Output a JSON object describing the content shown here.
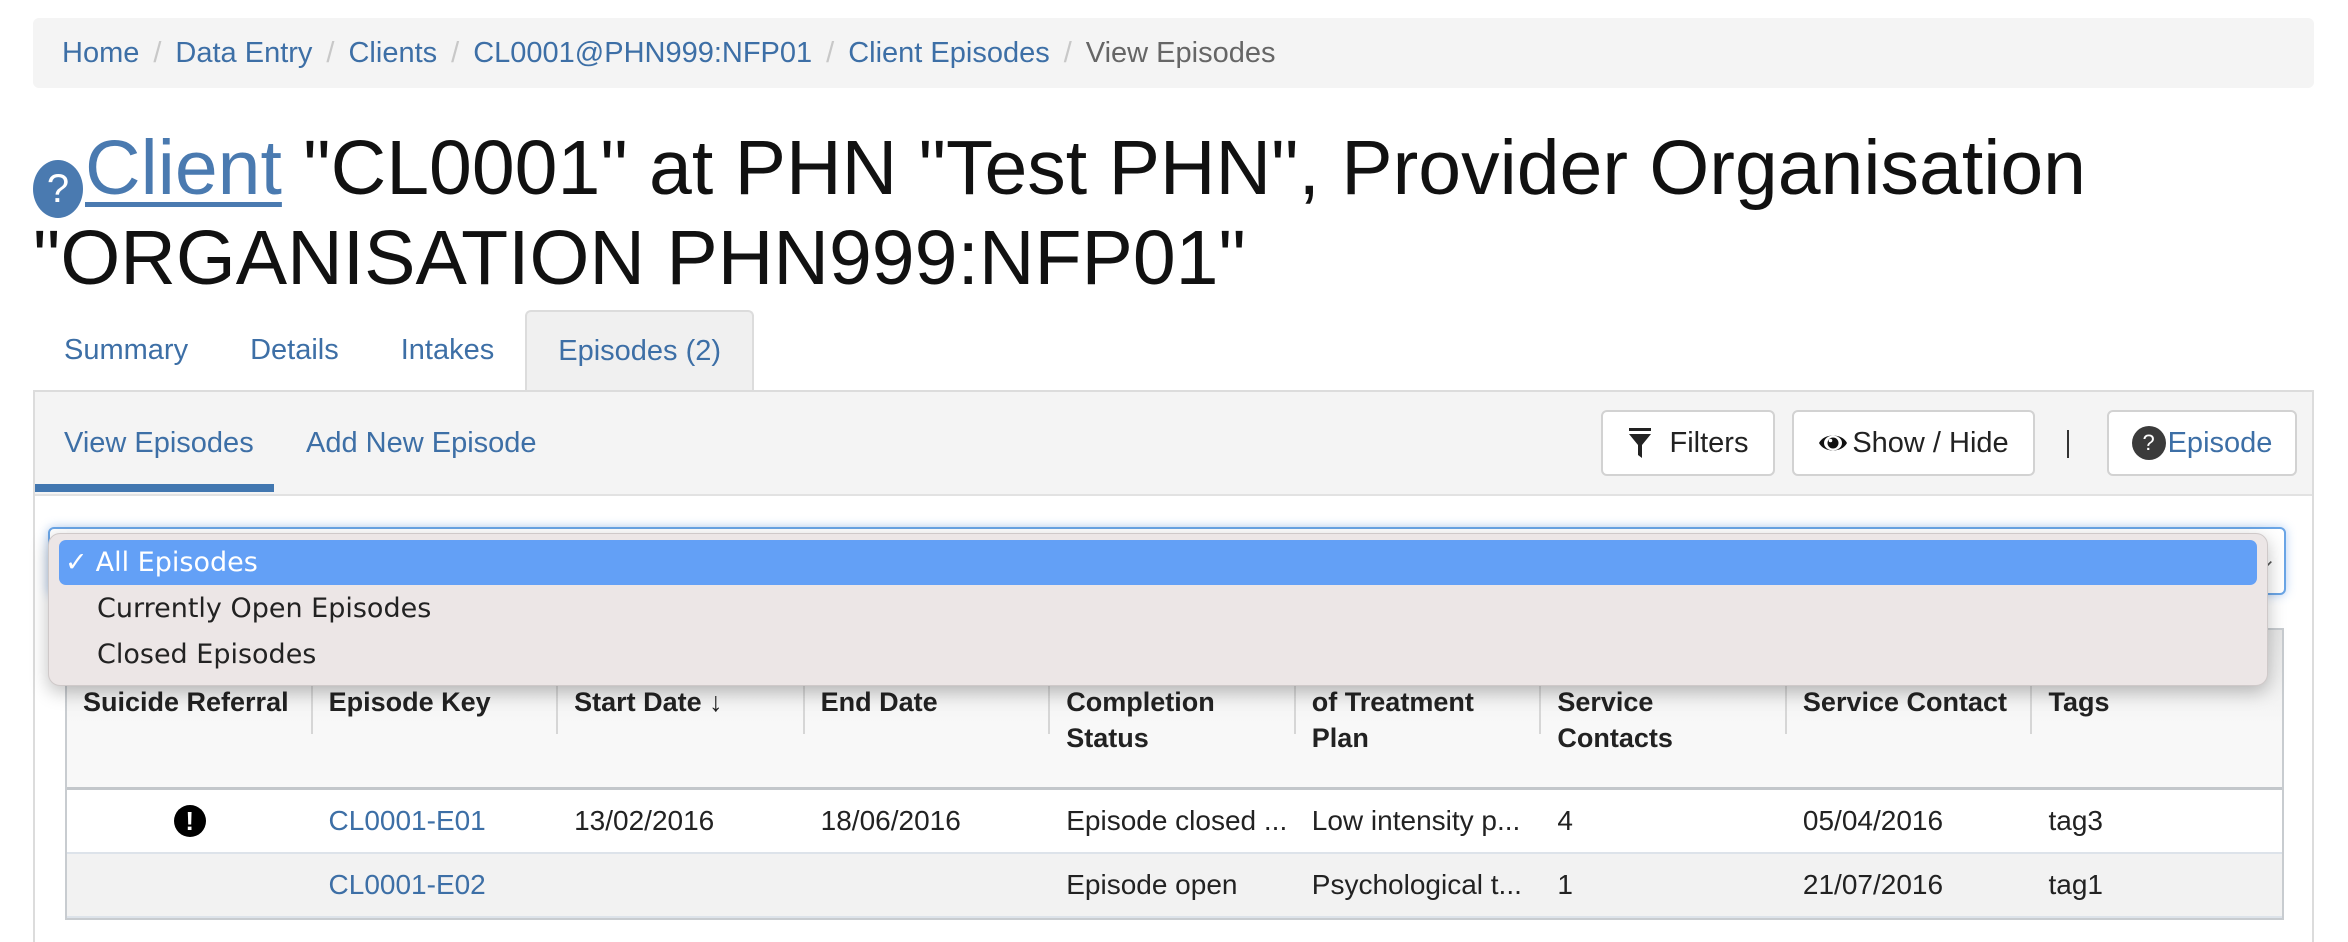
{
  "breadcrumb": {
    "items": [
      "Home",
      "Data Entry",
      "Clients",
      "CL0001@PHN999:NFP01",
      "Client Episodes"
    ],
    "current": "View Episodes",
    "separator": "/"
  },
  "title": {
    "help_glyph": "?",
    "link": "Client",
    "rest_line1": " \"CL0001\" at PHN \"Test PHN\", Provider Organisation",
    "rest_line2": "\"ORGANISATION PHN999:NFP01\""
  },
  "tabs": [
    {
      "label": "Summary"
    },
    {
      "label": "Details"
    },
    {
      "label": "Intakes"
    },
    {
      "label": "Episodes (2)",
      "active": true
    }
  ],
  "subnav": {
    "view_label": "View Episodes",
    "add_label": "Add New Episode"
  },
  "toolbar": {
    "filters_label": "Filters",
    "showhide_label": "Show / Hide",
    "separator": "|",
    "help_glyph": "?",
    "episode_label": "Episode"
  },
  "select": {
    "value": "All Episodes",
    "chevron": "⌄",
    "options": [
      {
        "label": "All Episodes",
        "selected": true,
        "check": "✓"
      },
      {
        "label": "Currently Open Episodes"
      },
      {
        "label": "Closed Episodes"
      }
    ]
  },
  "table": {
    "columns": [
      "Suicide Referral",
      "Episode Key",
      "Start Date ↓",
      "End Date",
      "Episode Completion Status",
      "Principal Focus of Treatment Plan",
      "Number of Service Contacts",
      "Date of Last Service Contact",
      "Tags"
    ],
    "rows": [
      {
        "suicide_referral": "!",
        "episode_key": "CL0001-E01",
        "start_date": "13/02/2016",
        "end_date": "18/06/2016",
        "completion_status": "Episode closed ...",
        "treatment_plan": "Low intensity p...",
        "service_contacts": "4",
        "last_contact": "05/04/2016",
        "tags": "tag3"
      },
      {
        "suicide_referral": "",
        "episode_key": "CL0001-E02",
        "start_date": "",
        "end_date": "",
        "completion_status": "Episode open",
        "treatment_plan": "Psychological t...",
        "service_contacts": "1",
        "last_contact": "21/07/2016",
        "tags": "tag1"
      }
    ]
  },
  "colors": {
    "link": "#3d6fa6",
    "accent": "#4277b0",
    "dropdown_highlight": "#63a0f6",
    "dropdown_bg": "#ece6e6"
  }
}
